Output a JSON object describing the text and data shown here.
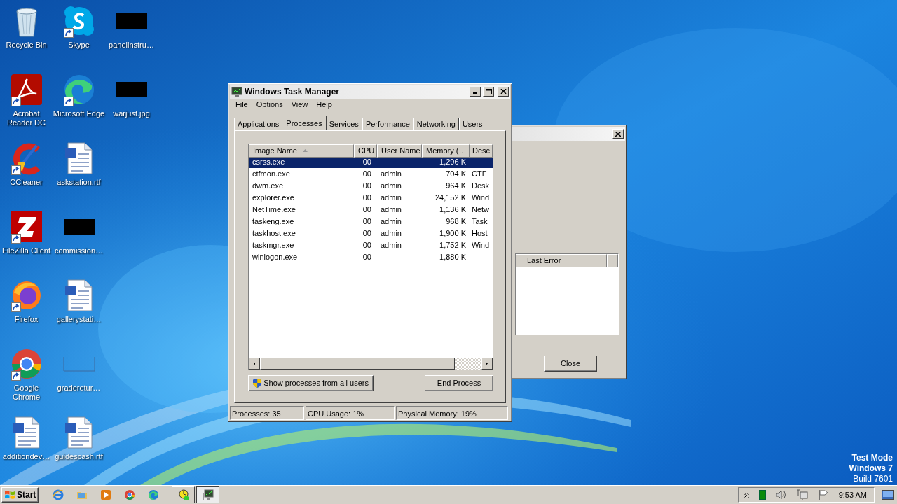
{
  "desktop_icons": [
    {
      "label": "Recycle Bin",
      "kind": "recycle-bin",
      "shortcut": false
    },
    {
      "label": "Acrobat Reader DC",
      "kind": "acrobat",
      "shortcut": true
    },
    {
      "label": "CCleaner",
      "kind": "ccleaner",
      "shortcut": true
    },
    {
      "label": "FileZilla Client",
      "kind": "filezilla",
      "shortcut": true
    },
    {
      "label": "Firefox",
      "kind": "firefox",
      "shortcut": true
    },
    {
      "label": "Google Chrome",
      "kind": "chrome",
      "shortcut": true
    },
    {
      "label": "additiondev…",
      "kind": "document",
      "shortcut": false
    },
    {
      "label": "Skype",
      "kind": "skype",
      "shortcut": true
    },
    {
      "label": "Microsoft Edge",
      "kind": "edge",
      "shortcut": true
    },
    {
      "label": "askstation.rtf",
      "kind": "document",
      "shortcut": false
    },
    {
      "label": "commission…",
      "kind": "hidden",
      "shortcut": false
    },
    {
      "label": "gallerystati…",
      "kind": "document",
      "shortcut": false
    },
    {
      "label": "graderetur…",
      "kind": "frame",
      "shortcut": false
    },
    {
      "label": "guidescash.rtf",
      "kind": "document",
      "shortcut": false
    },
    {
      "label": "panelinstru…",
      "kind": "hidden",
      "shortcut": false
    },
    {
      "label": "warjust.jpg",
      "kind": "hidden",
      "shortcut": false
    }
  ],
  "background_dialog": {
    "column_2": "Last Error",
    "button": "Close"
  },
  "task_manager": {
    "title": "Windows Task Manager",
    "menu": [
      "File",
      "Options",
      "View",
      "Help"
    ],
    "tabs": [
      {
        "label": "Applications",
        "selected": false
      },
      {
        "label": "Processes",
        "selected": true
      },
      {
        "label": "Services",
        "selected": false
      },
      {
        "label": "Performance",
        "selected": false
      },
      {
        "label": "Networking",
        "selected": false
      },
      {
        "label": "Users",
        "selected": false
      }
    ],
    "columns": [
      {
        "label": "Image Name",
        "sorted": true
      },
      {
        "label": "CPU",
        "sorted": false
      },
      {
        "label": "User Name",
        "sorted": false
      },
      {
        "label": "Memory (…",
        "sorted": false
      },
      {
        "label": "Desc",
        "sorted": false
      }
    ],
    "rows": [
      {
        "image_name": "csrss.exe",
        "cpu": "00",
        "memory": "1,296 K",
        "selected": true
      },
      {
        "image_name": "ctfmon.exe",
        "cpu": "00",
        "user_name": "admin",
        "memory": "704 K",
        "description": "CTF",
        "selected": false
      },
      {
        "image_name": "dwm.exe",
        "cpu": "00",
        "user_name": "admin",
        "memory": "964 K",
        "description": "Desk",
        "selected": false
      },
      {
        "image_name": "explorer.exe",
        "cpu": "00",
        "user_name": "admin",
        "memory": "24,152 K",
        "description": "Wind",
        "selected": false
      },
      {
        "image_name": "NetTime.exe",
        "cpu": "00",
        "user_name": "admin",
        "memory": "1,136 K",
        "description": "Netw",
        "selected": false
      },
      {
        "image_name": "taskeng.exe",
        "cpu": "00",
        "user_name": "admin",
        "memory": "968 K",
        "description": "Task",
        "selected": false
      },
      {
        "image_name": "taskhost.exe",
        "cpu": "00",
        "user_name": "admin",
        "memory": "1,900 K",
        "description": "Host",
        "selected": false
      },
      {
        "image_name": "taskmgr.exe",
        "cpu": "00",
        "user_name": "admin",
        "memory": "1,752 K",
        "description": "Wind",
        "selected": false
      },
      {
        "image_name": "winlogon.exe",
        "cpu": "00",
        "memory": "1,880 K",
        "selected": false
      }
    ],
    "show_all_button": "Show processes from all users",
    "end_button": "End Process",
    "status_bar": [
      "Processes: 35",
      "CPU Usage: 1%",
      "Physical Memory: 19%"
    ]
  },
  "os_notice": [
    "Test Mode",
    "Windows 7",
    "Build 7601"
  ],
  "taskbar": {
    "start": "Start",
    "quick_launch": [
      {
        "kind": "browser"
      },
      {
        "kind": "folder"
      },
      {
        "kind": "media"
      },
      {
        "kind": "chrome"
      },
      {
        "kind": "edge"
      }
    ],
    "tasks": [
      {
        "kind": "clock",
        "selected": false
      },
      {
        "kind": "monitor",
        "selected": true
      }
    ],
    "clock": "9:53 AM"
  }
}
